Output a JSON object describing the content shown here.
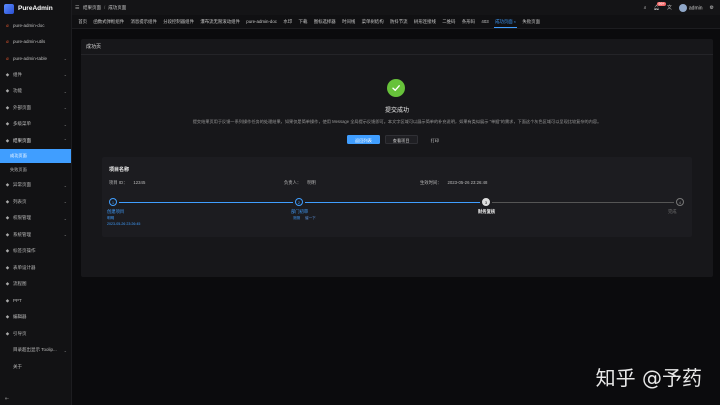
{
  "app": {
    "name": "PureAdmin"
  },
  "sidebar": {
    "items": [
      {
        "label": "pure-admin-doc",
        "icon": "link-icon",
        "arrow": ""
      },
      {
        "label": "pure-admin-utils",
        "icon": "link-icon",
        "arrow": ""
      },
      {
        "label": "pure-admin-table",
        "icon": "link-icon",
        "arrow": "⌄"
      },
      {
        "label": "组件",
        "icon": "grid-icon",
        "arrow": "⌄"
      },
      {
        "label": "功能",
        "icon": "flag-icon",
        "arrow": "⌄"
      },
      {
        "label": "外部页面",
        "icon": "monitor-icon",
        "arrow": "⌄"
      },
      {
        "label": "多级菜单",
        "icon": "menu-icon",
        "arrow": "⌄"
      },
      {
        "label": "结果页面",
        "icon": "check-circle-icon",
        "arrow": "⌃"
      }
    ],
    "sub_items": [
      {
        "label": "成功页面",
        "active": true
      },
      {
        "label": "失败页面",
        "active": false
      }
    ],
    "items_after": [
      {
        "label": "异常页面",
        "icon": "warning-icon",
        "arrow": "⌄"
      },
      {
        "label": "列表页",
        "icon": "list-icon",
        "arrow": "⌄"
      },
      {
        "label": "权限管理",
        "icon": "lock-icon",
        "arrow": "⌄"
      },
      {
        "label": "系统管理",
        "icon": "gear-icon",
        "arrow": "⌄"
      },
      {
        "label": "标签页操作",
        "icon": "tag-icon",
        "arrow": ""
      },
      {
        "label": "表单设计器",
        "icon": "form-icon",
        "arrow": ""
      },
      {
        "label": "流程图",
        "icon": "flow-icon",
        "arrow": ""
      },
      {
        "label": "PPT",
        "icon": "slides-icon",
        "arrow": ""
      },
      {
        "label": "编辑器",
        "icon": "edit-icon",
        "arrow": ""
      },
      {
        "label": "引导页",
        "icon": "guide-icon",
        "arrow": ""
      },
      {
        "label": "目录超出显示 Toolip...",
        "icon": "",
        "arrow": "⌄"
      },
      {
        "label": "关于",
        "icon": "",
        "arrow": ""
      }
    ],
    "collapse_icon": "⇤"
  },
  "topbar": {
    "breadcrumb": [
      "结果页面",
      "成功页面"
    ],
    "notification_count": "99+",
    "username": "admin"
  },
  "tabs": [
    "首页",
    "函数式弹框组件",
    "消息提示组件",
    "分段控制器组件",
    "瀑布流无限滚动组件",
    "pure-admin-doc",
    "水印",
    "下载",
    "图标选择器",
    "时间线",
    "菜单树结构",
    "防抖节流",
    "树形连接线",
    "二维码",
    "条形码",
    "403",
    "成功页面",
    "失败页面"
  ],
  "active_tab": "成功页面",
  "card": {
    "header": "成功页",
    "title": "提交成功",
    "subtitle": "提交结果页用于反馈一系列操作任务的处理结果，如果仅是简单操作，使用 Message 全局提示反馈即可。本文字区域可以展示简单的补充说明，如果有类似展示 “单据”的需求，下面这个灰色区域可以呈现比较复杂的内容。",
    "buttons": {
      "primary": "返回列表",
      "secondary": "查看项目",
      "text": "打印"
    }
  },
  "detail": {
    "title": "项目名称",
    "project_id_label": "项目 ID：",
    "project_id": "12345",
    "owner_label": "负责人：",
    "owner": "明明",
    "time_label": "生效时间：",
    "time": "2023-05-26 23:26:48"
  },
  "steps": [
    {
      "n": "1",
      "label": "创建项目",
      "desc1": "明明",
      "desc2": "2023-05-26 23:26:45",
      "state": "done"
    },
    {
      "n": "2",
      "label": "部门初审",
      "desc1": "测测",
      "desc2": "催一下",
      "state": "done"
    },
    {
      "n": "3",
      "label": "财务复核",
      "desc1": "",
      "desc2": "",
      "state": "current"
    },
    {
      "n": "4",
      "label": "完成",
      "desc1": "",
      "desc2": "",
      "state": "wait"
    }
  ],
  "watermark": "知乎 @予药",
  "colors": {
    "primary": "#409eff",
    "success": "#67c23a",
    "danger": "#f56c6c"
  }
}
